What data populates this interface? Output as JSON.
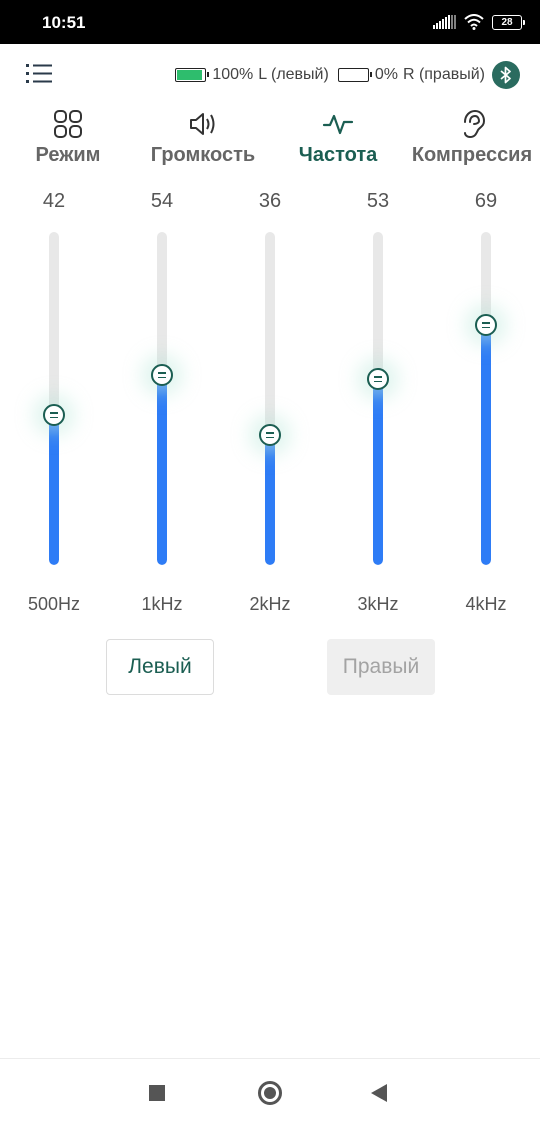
{
  "status_bar": {
    "time": "10:51",
    "battery_level": "28"
  },
  "header": {
    "left": {
      "percent": "100%",
      "label": "L (левый)",
      "charge": 1.0
    },
    "right": {
      "percent": "0%",
      "label": "R (правый)",
      "charge": 0.0
    },
    "icons": [
      "menu-icon",
      "bluetooth-icon"
    ]
  },
  "tabs": [
    {
      "label": "Режим",
      "icon": "grid-icon",
      "active": false
    },
    {
      "label": "Громкость",
      "icon": "speaker-icon",
      "active": false
    },
    {
      "label": "Частота",
      "icon": "pulse-icon",
      "active": true
    },
    {
      "label": "Компрессия",
      "icon": "ear-icon",
      "active": false
    }
  ],
  "equalizer": {
    "bands": [
      {
        "value": "42",
        "freq": "500Hz",
        "level": 0.45
      },
      {
        "value": "54",
        "freq": "1kHz",
        "level": 0.57
      },
      {
        "value": "36",
        "freq": "2kHz",
        "level": 0.39
      },
      {
        "value": "53",
        "freq": "3kHz",
        "level": 0.56
      },
      {
        "value": "69",
        "freq": "4kHz",
        "level": 0.72
      }
    ]
  },
  "ear_buttons": {
    "left": "Левый",
    "right": "Правый",
    "selected": "left"
  },
  "colors": {
    "accent": "#1b5e52",
    "slider_fill": "#2e7cf6",
    "track": "#e8e8e8",
    "battery_green": "#2ebd6d",
    "bluetooth_bg": "#2a6b5f"
  },
  "nav_bar": {
    "icons": [
      "recents-square-icon",
      "home-circle-icon",
      "back-triangle-icon"
    ]
  }
}
